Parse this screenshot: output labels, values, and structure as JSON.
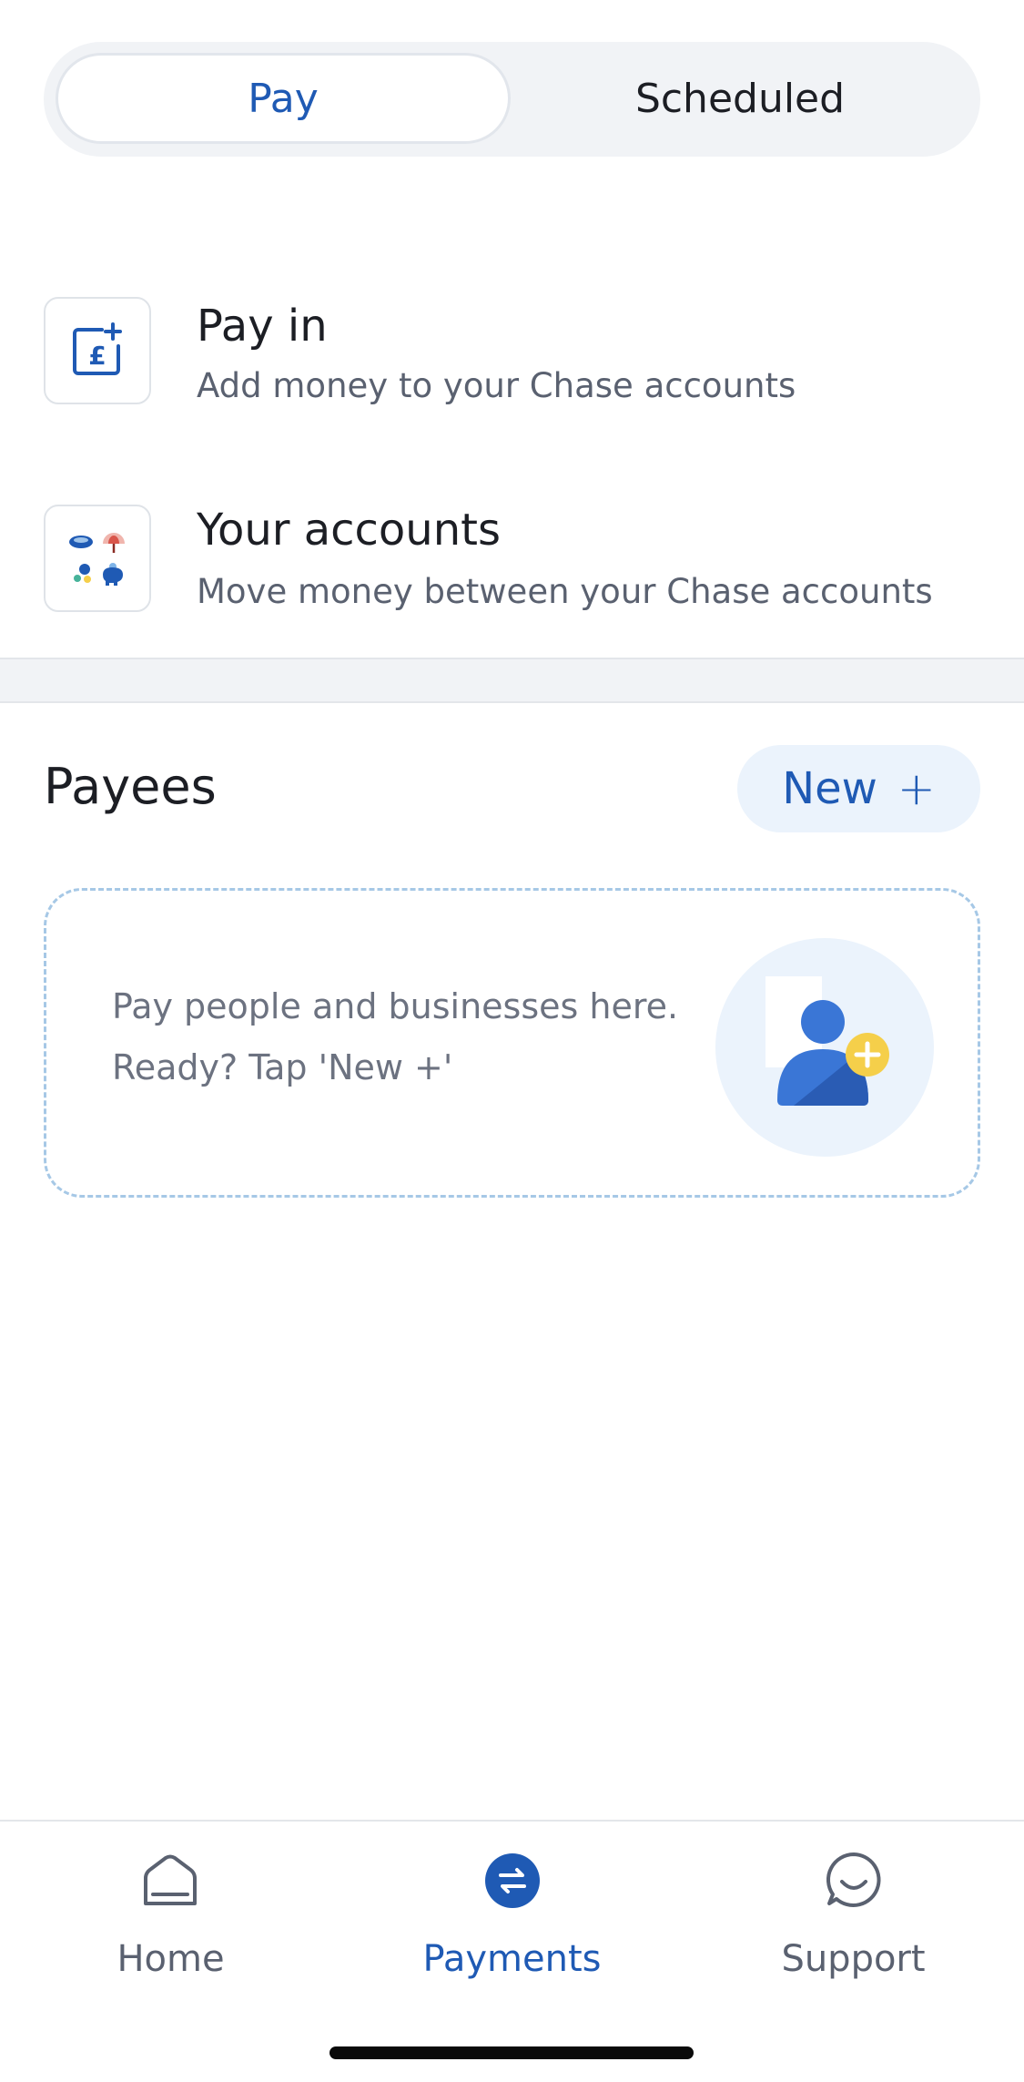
{
  "segment": {
    "pay_label": "Pay",
    "scheduled_label": "Scheduled",
    "active": "Pay"
  },
  "actions": [
    {
      "title": "Pay in",
      "subtitle": "Add money to your Chase accounts",
      "icon": "pound-plus-icon"
    },
    {
      "title": "Your accounts",
      "subtitle": "Move money between your Chase accounts",
      "icon": "account-icons-grid"
    }
  ],
  "payees": {
    "title": "Payees",
    "new_label": "New",
    "new_icon": "plus-icon",
    "empty_line1": "Pay people and businesses here.",
    "empty_line2": "Ready? Tap 'New +'",
    "illustration": "add-person-icon"
  },
  "nav": [
    {
      "label": "Home",
      "icon": "home-icon",
      "active": false
    },
    {
      "label": "Payments",
      "icon": "transfer-arrows-icon",
      "active": true
    },
    {
      "label": "Support",
      "icon": "chat-bubble-icon",
      "active": false
    }
  ],
  "colors": {
    "accent": "#1f5ab4",
    "muted": "#5a6170",
    "band": "#f1f3f6",
    "yellow": "#f5cf4a"
  }
}
